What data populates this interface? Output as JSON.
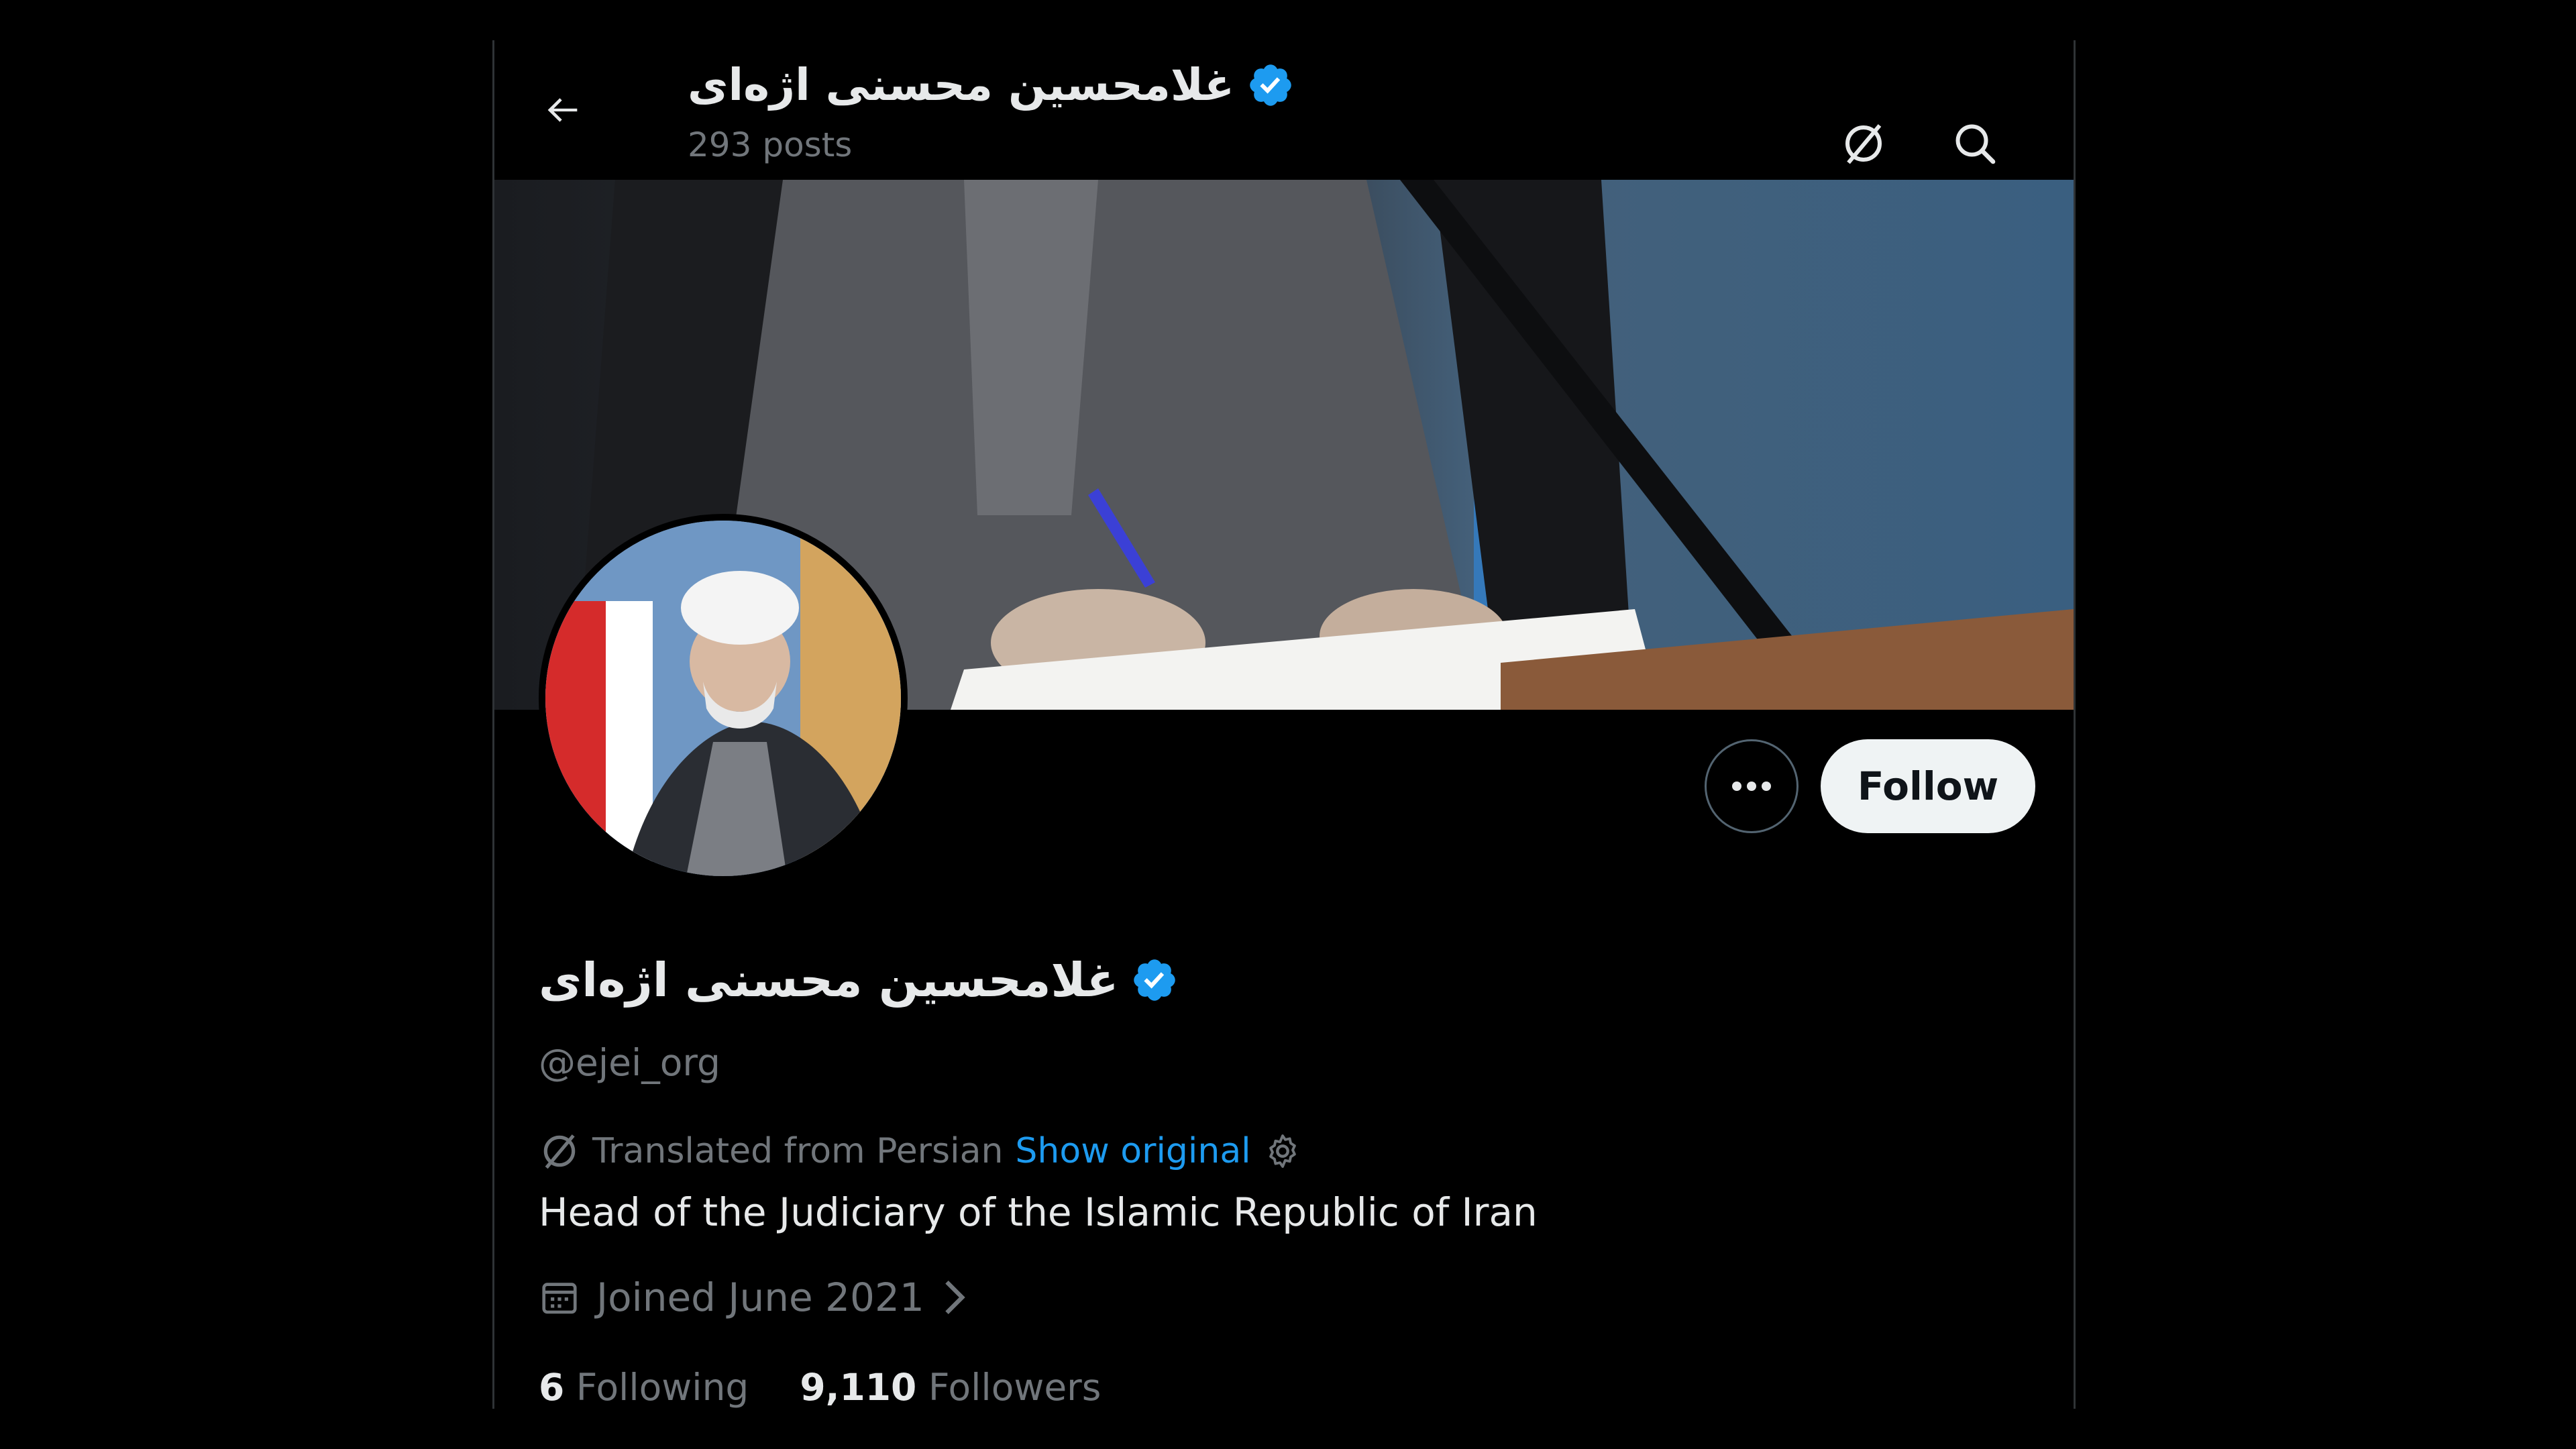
{
  "header": {
    "name": "غلامحسین محسنی اژه‌ای",
    "posts": "293 posts"
  },
  "profile": {
    "name": "غلامحسین محسنی اژه‌ای",
    "handle": "@ejei_org",
    "verified": true,
    "translation": {
      "label": "Translated from Persian",
      "show_original": "Show original"
    },
    "bio": "Head of the Judiciary of the Islamic Republic of Iran",
    "joined": "Joined June 2021",
    "following_count": "6",
    "following_label": "Following",
    "followers_count": "9,110",
    "followers_label": "Followers"
  },
  "actions": {
    "follow_label": "Follow"
  },
  "colors": {
    "background": "#000000",
    "text_primary": "#e7e9ea",
    "text_secondary": "#71767b",
    "accent": "#1d9bf0",
    "verified_badge": "#1d9bf0",
    "follow_button": "#eff3f4"
  },
  "icons": [
    "back-arrow-icon",
    "translate-icon",
    "search-icon",
    "verified-badge-icon",
    "more-dots-icon",
    "calendar-icon",
    "chevron-right-icon",
    "settings-gear-icon"
  ]
}
